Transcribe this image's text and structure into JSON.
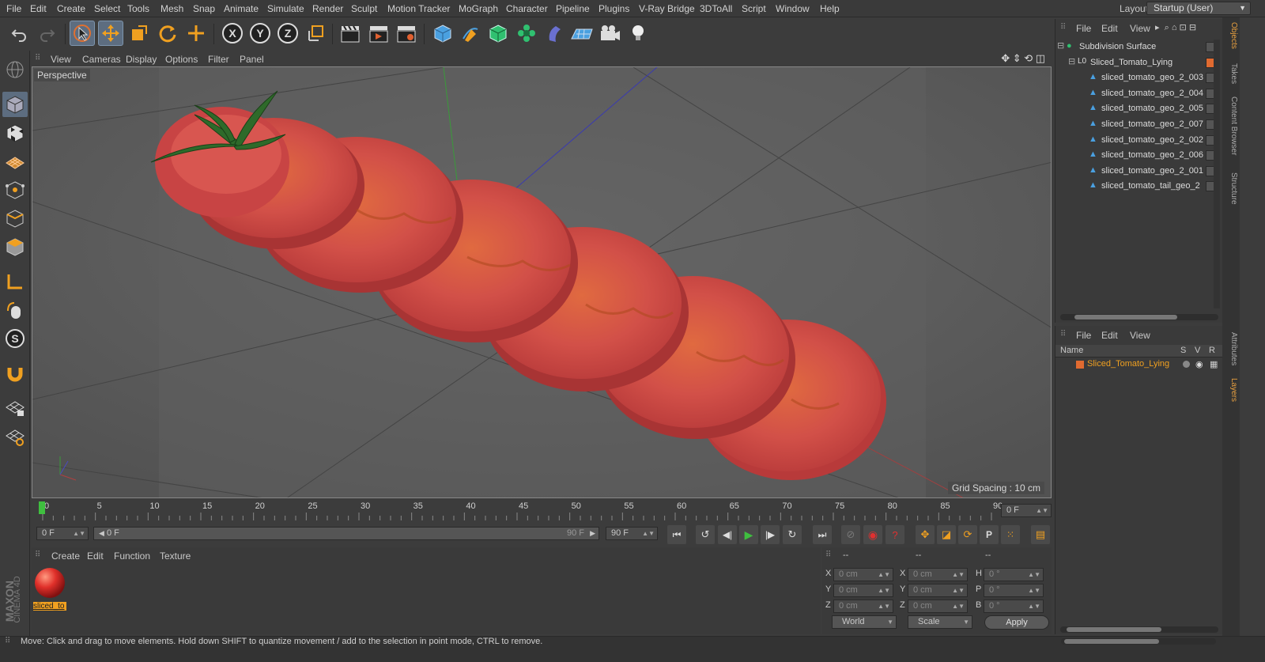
{
  "menu": [
    "File",
    "Edit",
    "Create",
    "Select",
    "Tools",
    "Mesh",
    "Snap",
    "Animate",
    "Simulate",
    "Render",
    "Sculpt",
    "Motion Tracker",
    "MoGraph",
    "Character",
    "Pipeline",
    "Plugins",
    "V-Ray Bridge",
    "3DToAll",
    "Script",
    "Window",
    "Help"
  ],
  "layout": {
    "label": "Layout:",
    "value": "Startup (User)"
  },
  "viewport": {
    "menu": [
      "View",
      "Cameras",
      "Display",
      "Options",
      "Filter",
      "Panel"
    ],
    "label": "Perspective",
    "grid_spacing": "Grid Spacing : 10 cm"
  },
  "timeline": {
    "ticks": [
      "0",
      "5",
      "10",
      "15",
      "20",
      "25",
      "30",
      "35",
      "40",
      "45",
      "50",
      "55",
      "60",
      "65",
      "70",
      "75",
      "80",
      "85",
      "90"
    ],
    "current_frame": "0 F"
  },
  "transport": {
    "start": "0 F",
    "range_start": "0 F",
    "range_end": "90 F",
    "end": "90 F"
  },
  "material_manager": {
    "menu": [
      "Create",
      "Edit",
      "Function",
      "Texture"
    ],
    "material_name": "sliced_to"
  },
  "coords": {
    "header": [
      "--",
      "--",
      "--"
    ],
    "rows": [
      {
        "a": "X",
        "av": "0 cm",
        "b": "X",
        "bv": "0 cm",
        "c": "H",
        "cv": "0 °"
      },
      {
        "a": "Y",
        "av": "0 cm",
        "b": "Y",
        "bv": "0 cm",
        "c": "P",
        "cv": "0 °"
      },
      {
        "a": "Z",
        "av": "0 cm",
        "b": "Z",
        "bv": "0 cm",
        "c": "B",
        "cv": "0 °"
      }
    ],
    "mode1": "World",
    "mode2": "Scale",
    "apply": "Apply"
  },
  "objects": {
    "menu": [
      "File",
      "Edit",
      "View"
    ],
    "items": [
      {
        "name": "Subdivision Surface",
        "indent": 0
      },
      {
        "name": "Sliced_Tomato_Lying",
        "indent": 1
      },
      {
        "name": "sliced_tomato_geo_2_003",
        "indent": 2
      },
      {
        "name": "sliced_tomato_geo_2_004",
        "indent": 2
      },
      {
        "name": "sliced_tomato_geo_2_005",
        "indent": 2
      },
      {
        "name": "sliced_tomato_geo_2_007",
        "indent": 2
      },
      {
        "name": "sliced_tomato_geo_2_002",
        "indent": 2
      },
      {
        "name": "sliced_tomato_geo_2_006",
        "indent": 2
      },
      {
        "name": "sliced_tomato_geo_2_001",
        "indent": 2
      },
      {
        "name": "sliced_tomato_tail_geo_2",
        "indent": 2
      }
    ]
  },
  "layers": {
    "menu": [
      "File",
      "Edit",
      "View"
    ],
    "columns": {
      "name": "Name",
      "s": "S",
      "v": "V",
      "r": "R"
    },
    "row": "Sliced_Tomato_Lying"
  },
  "right_tabs": [
    "Objects",
    "Takes",
    "Content Browser",
    "Structure",
    "Attributes",
    "Layers"
  ],
  "brand": {
    "line1": "MAXON",
    "line2": "CINEMA 4D"
  },
  "status": "Move: Click and drag to move elements. Hold down SHIFT to quantize movement / add to the selection in point mode, CTRL to remove.",
  "colors": {
    "accent": "#e8a040",
    "selection": "#5d6d80",
    "tomato": "#d8504a",
    "play": "#3fbf3f"
  }
}
